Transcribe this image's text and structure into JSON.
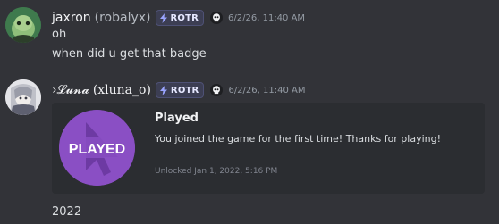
{
  "messages": [
    {
      "display_name": "jaxron",
      "username": "(robalyx)",
      "tag": "ROTR",
      "timestamp": "6/2/26, 11:40 AM",
      "lines": [
        "oh",
        "when did u get that badge"
      ]
    },
    {
      "display_name": "›𝓛𝓾𝓷𝓪",
      "username": "(xluna_o)",
      "tag": "ROTR",
      "timestamp": "6/2/26, 11:40 AM",
      "embed": {
        "icon_text": "PLAYED",
        "title": "Played",
        "description": "You joined the game for the first time! Thanks for playing!",
        "footer": "Unlocked Jan 1, 2022, 5:16 PM"
      },
      "lines": [
        "2022"
      ]
    }
  ],
  "colors": {
    "background": "#323338",
    "embed_background": "#2b2d31",
    "badge_purple": "#8a4fc4",
    "tag_background": "#3c3e53",
    "timestamp": "#949ba4"
  },
  "icons": {
    "tag": "lightning-bolt-icon",
    "guild": "skull-icon",
    "embed": "cursor-arrow-icon"
  }
}
